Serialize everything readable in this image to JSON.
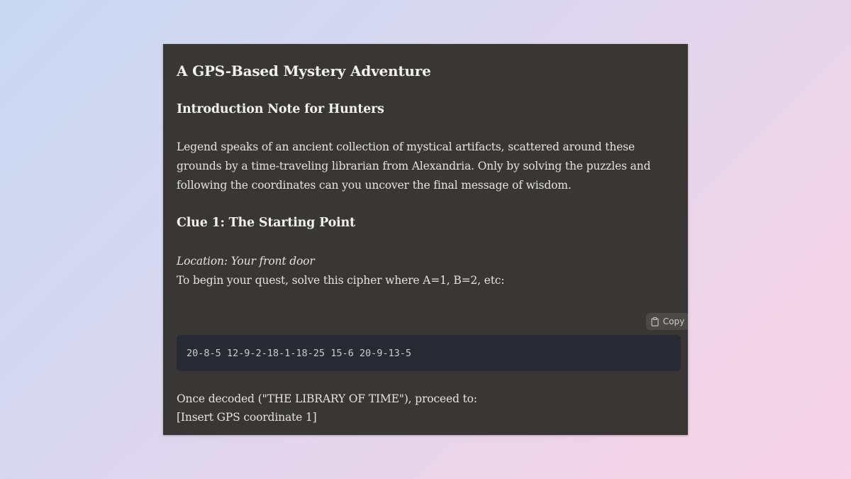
{
  "document": {
    "title": "A GPS-Based Mystery Adventure",
    "intro_heading": "Introduction Note for Hunters",
    "intro_text": "Legend speaks of an ancient collection of mystical artifacts, scattered around these grounds by a time-traveling librarian from Alexandria. Only by solving the puzzles and following the coordinates can you uncover the final message of wisdom.",
    "clue1": {
      "heading": "Clue 1: The Starting Point",
      "location": "Location: Your front door",
      "instruction": "To begin your quest, solve this cipher where A=1, B=2, etc:",
      "code": "20-8-5 12-9-2-18-1-18-25 15-6 20-9-13-5",
      "decoded": "Once decoded (\"THE LIBRARY OF TIME\"), proceed to:",
      "coordinate": "[Insert GPS coordinate 1]"
    }
  },
  "code_toolbar": {
    "copy_label": "Copy",
    "copy_icon": "clipboard-icon"
  },
  "colors": {
    "card_background": "#383735",
    "code_background": "#272a33",
    "text": "#e6e3dc",
    "page_gradient_start": "#c9d9f3",
    "page_gradient_end": "#f5d2e4"
  }
}
